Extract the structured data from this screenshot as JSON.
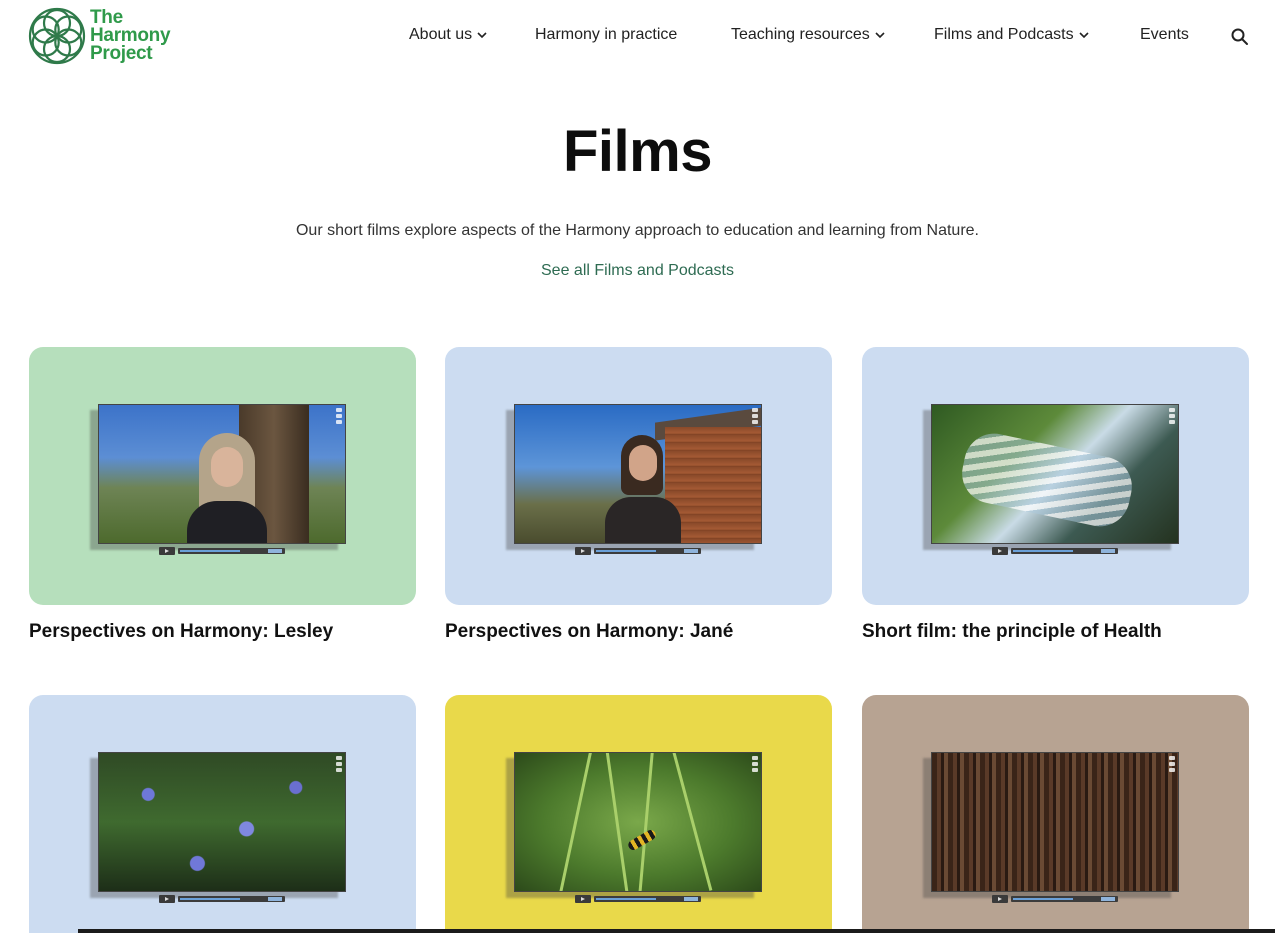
{
  "brand": {
    "line1": "The",
    "line2": "Harmony",
    "line3": "Project",
    "color": "#2f9a4a"
  },
  "nav": {
    "items": [
      {
        "label": "About us",
        "has_dropdown": true
      },
      {
        "label": "Harmony in practice",
        "has_dropdown": false
      },
      {
        "label": "Teaching resources",
        "has_dropdown": true
      },
      {
        "label": "Films and Podcasts",
        "has_dropdown": true
      },
      {
        "label": "Events",
        "has_dropdown": false
      }
    ],
    "search_icon": "search-icon"
  },
  "hero": {
    "title": "Films",
    "intro": "Our short films explore aspects of the Harmony approach to education and learning from Nature.",
    "see_all": "See all Films and Podcasts",
    "link_color": "#2e6b52"
  },
  "films": [
    {
      "title": "Perspectives on Harmony: Lesley",
      "bg_color": "#b6dfbc",
      "scene": "portrait of a woman by a tree"
    },
    {
      "title": "Perspectives on Harmony: Jané",
      "bg_color": "#ccdcf1",
      "scene": "portrait of a woman by a wooden shed"
    },
    {
      "title": "Short film: the principle of Health",
      "bg_color": "#ccdcf1",
      "scene": "stream flowing over rocks"
    },
    {
      "title": "",
      "bg_color": "#ccdcf1",
      "scene": "wild blue flowers"
    },
    {
      "title": "",
      "bg_color": "#e9d94a",
      "scene": "caterpillar on grass"
    },
    {
      "title": "",
      "bg_color": "#b7a392",
      "scene": "tree bark"
    }
  ]
}
